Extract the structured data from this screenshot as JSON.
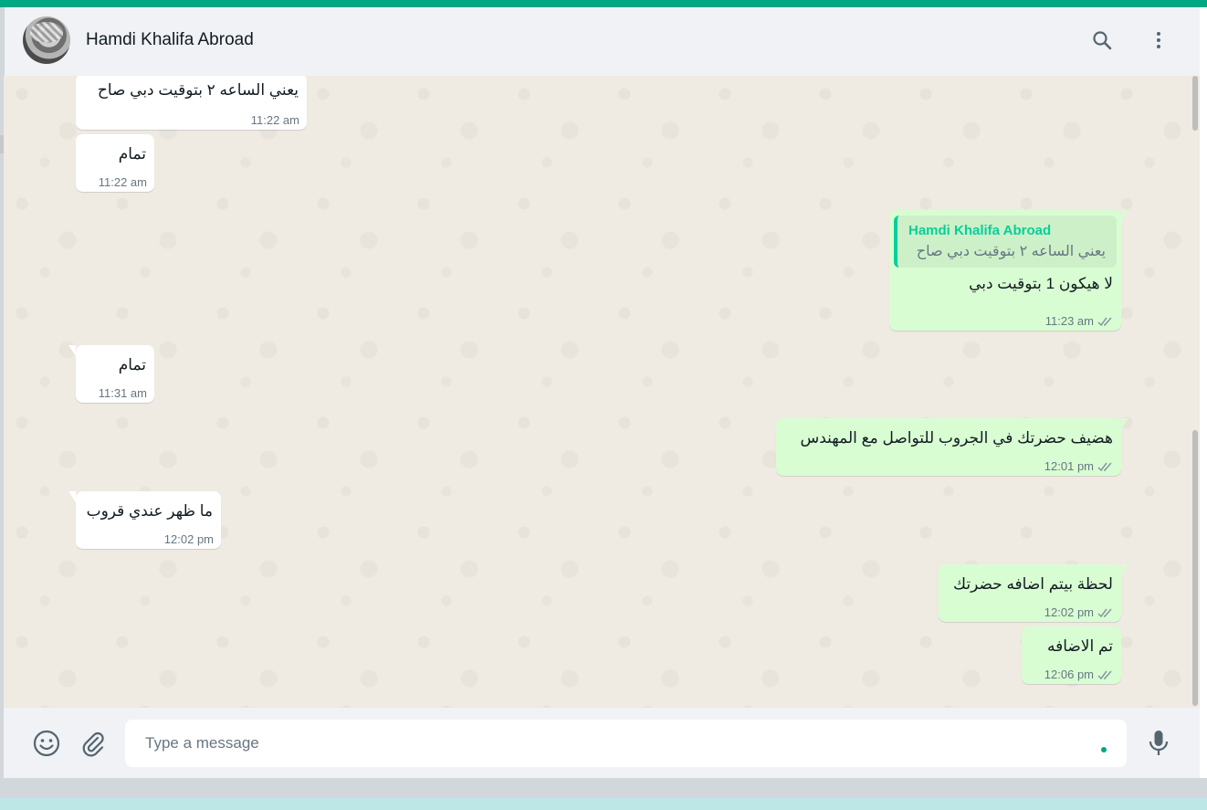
{
  "header": {
    "contact_name": "Hamdi Khalifa Abroad",
    "icons": [
      "search-icon",
      "menu-icon"
    ]
  },
  "messages": [
    {
      "direction": "in",
      "text": "يعني الساعه ٢ بتوقيت دبي صاح",
      "time": "11:22 am"
    },
    {
      "direction": "in",
      "text": "تمام",
      "time": "11:22 am"
    },
    {
      "direction": "out",
      "quote_author": "Hamdi Khalifa Abroad",
      "quote_text": "يعني الساعه ٢ بتوقيت دبي صاح",
      "text": "لا هيكون 1 بتوقيت دبي",
      "time": "11:23 am"
    },
    {
      "direction": "in",
      "text": "تمام",
      "time": "11:31 am"
    },
    {
      "direction": "out",
      "text": "هضيف حضرتك في الجروب للتواصل مع المهندس",
      "time": "12:01 pm"
    },
    {
      "direction": "in",
      "text": "ما ظهر عندي قروب",
      "time": "12:02 pm"
    },
    {
      "direction": "out",
      "text": "لحظة بيتم اضافه حضرتك",
      "time": "12:02 pm"
    },
    {
      "direction": "out",
      "text": "تم الاضافه",
      "time": "12:06 pm"
    }
  ],
  "composer": {
    "placeholder": "Type a message",
    "icons": [
      "emoji-icon",
      "attach-icon",
      "mic-icon"
    ]
  },
  "colors": {
    "accent": "#00a884",
    "outgoing_bubble": "#d9fdd3",
    "incoming_bubble": "#ffffff",
    "chat_background": "#efeae2",
    "header_background": "#f0f2f5"
  }
}
